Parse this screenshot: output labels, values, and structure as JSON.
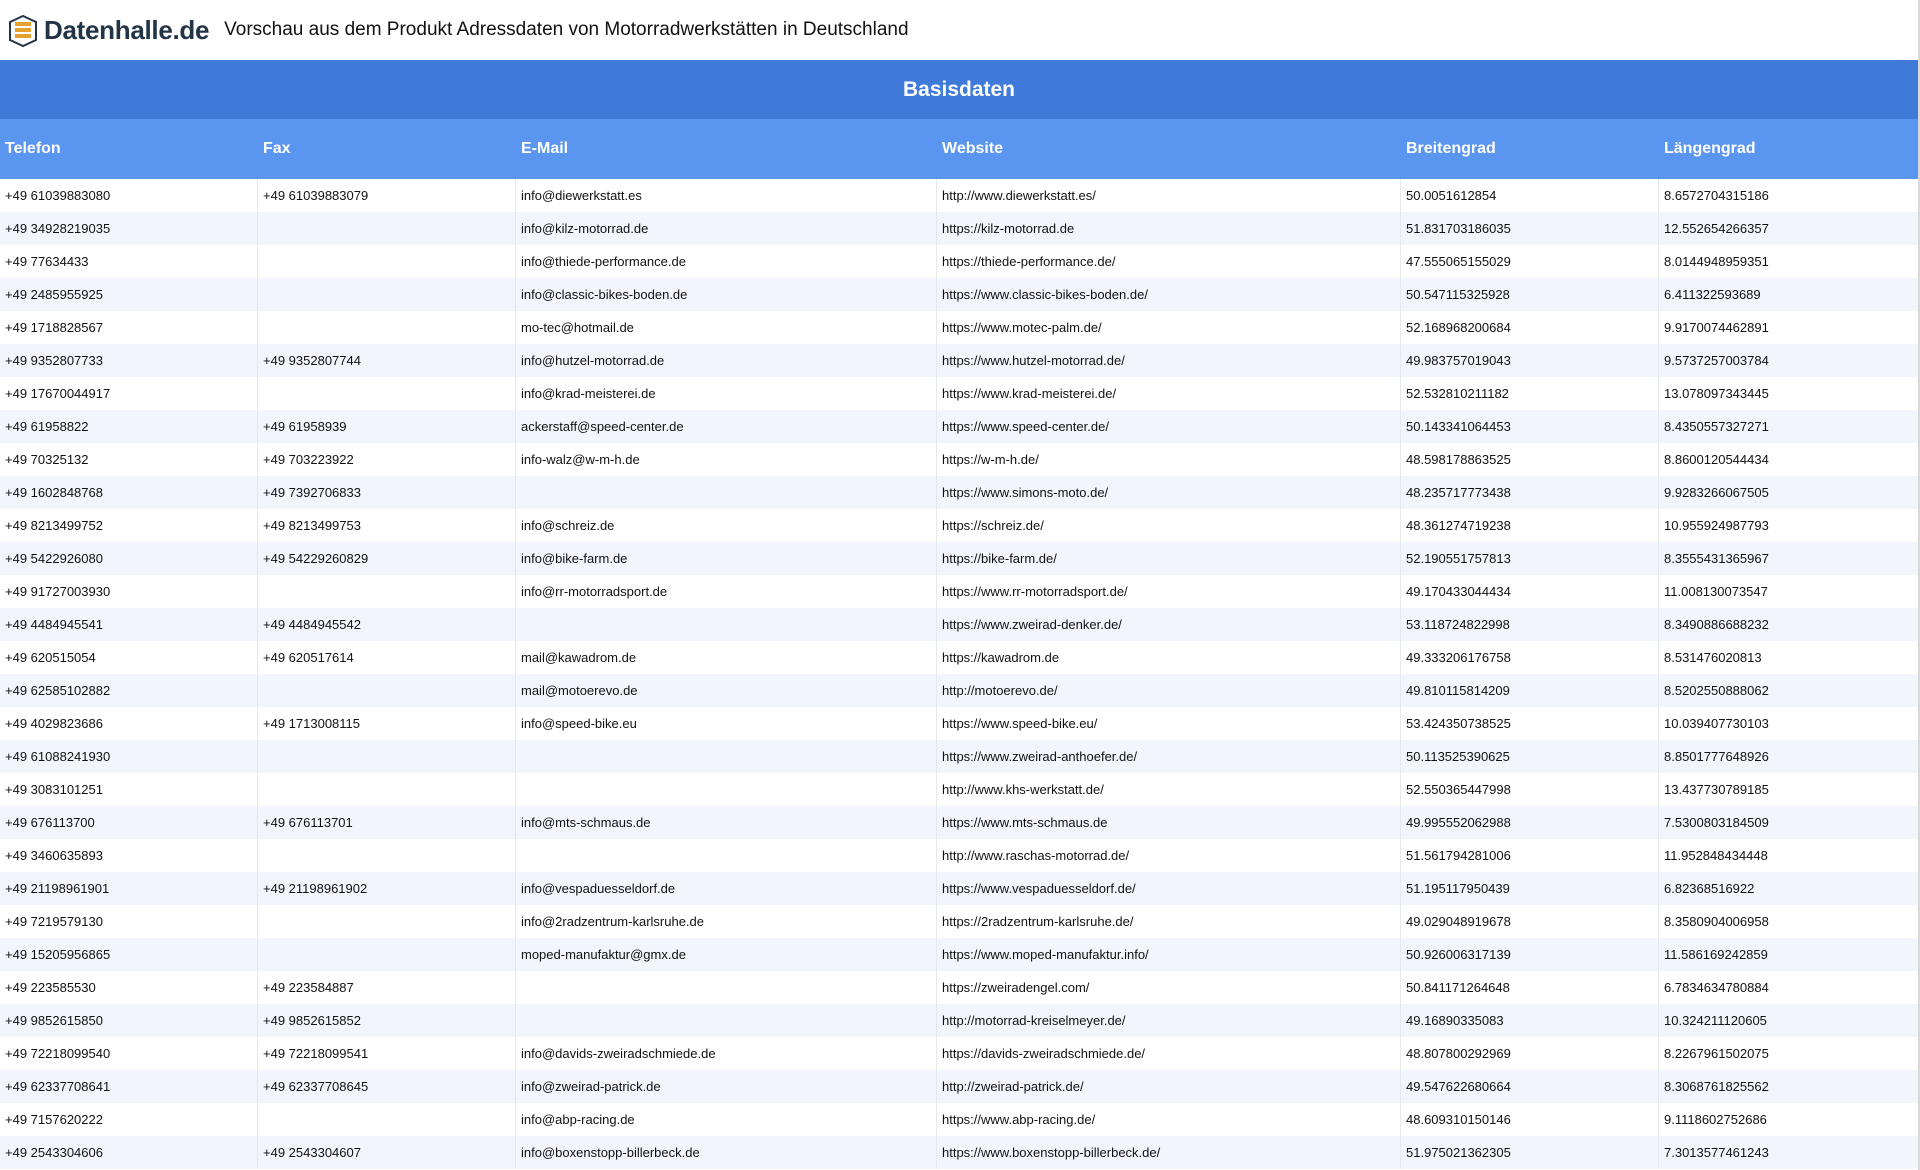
{
  "header": {
    "logo_text": "Datenhalle.de",
    "title": "Vorschau aus dem Produkt Adressdaten von Motorradwerkstätten in Deutschland"
  },
  "table": {
    "group_title": "Basisdaten",
    "columns": [
      "Telefon",
      "Fax",
      "E-Mail",
      "Website",
      "Breitengrad",
      "Längengrad"
    ],
    "rows": [
      [
        "+49 61039883080",
        "+49 61039883079",
        "info@diewerkstatt.es",
        "http://www.diewerkstatt.es/",
        "50.0051612854",
        "8.6572704315186"
      ],
      [
        "+49 34928219035",
        "",
        "info@kilz-motorrad.de",
        "https://kilz-motorrad.de",
        "51.831703186035",
        "12.552654266357"
      ],
      [
        "+49 77634433",
        "",
        "info@thiede-performance.de",
        "https://thiede-performance.de/",
        "47.555065155029",
        "8.0144948959351"
      ],
      [
        "+49 2485955925",
        "",
        "info@classic-bikes-boden.de",
        "https://www.classic-bikes-boden.de/",
        "50.547115325928",
        "6.411322593689"
      ],
      [
        "+49 1718828567",
        "",
        "mo-tec@hotmail.de",
        "https://www.motec-palm.de/",
        "52.168968200684",
        "9.9170074462891"
      ],
      [
        "+49 9352807733",
        "+49 9352807744",
        "info@hutzel-motorrad.de",
        "https://www.hutzel-motorrad.de/",
        "49.983757019043",
        "9.5737257003784"
      ],
      [
        "+49 17670044917",
        "",
        "info@krad-meisterei.de",
        "https://www.krad-meisterei.de/",
        "52.532810211182",
        "13.078097343445"
      ],
      [
        "+49 61958822",
        "+49 61958939",
        "ackerstaff@speed-center.de",
        "https://www.speed-center.de/",
        "50.143341064453",
        "8.4350557327271"
      ],
      [
        "+49 70325132",
        "+49 703223922",
        "info-walz@w-m-h.de",
        "https://w-m-h.de/",
        "48.598178863525",
        "8.8600120544434"
      ],
      [
        "+49 1602848768",
        "+49 7392706833",
        "",
        "https://www.simons-moto.de/",
        "48.235717773438",
        "9.9283266067505"
      ],
      [
        "+49 8213499752",
        "+49 8213499753",
        "info@schreiz.de",
        "https://schreiz.de/",
        "48.361274719238",
        "10.955924987793"
      ],
      [
        "+49 5422926080",
        "+49 54229260829",
        "info@bike-farm.de",
        "https://bike-farm.de/",
        "52.190551757813",
        "8.3555431365967"
      ],
      [
        "+49 91727003930",
        "",
        "info@rr-motorradsport.de",
        "https://www.rr-motorradsport.de/",
        "49.170433044434",
        "11.008130073547"
      ],
      [
        "+49 4484945541",
        "+49 4484945542",
        "",
        "https://www.zweirad-denker.de/",
        "53.118724822998",
        "8.3490886688232"
      ],
      [
        "+49 620515054",
        "+49 620517614",
        "mail@kawadrom.de",
        "https://kawadrom.de",
        "49.333206176758",
        "8.531476020813"
      ],
      [
        "+49 62585102882",
        "",
        "mail@motoerevo.de",
        "http://motoerevo.de/",
        "49.810115814209",
        "8.5202550888062"
      ],
      [
        "+49 4029823686",
        "+49 1713008115",
        "info@speed-bike.eu",
        "https://www.speed-bike.eu/",
        "53.424350738525",
        "10.039407730103"
      ],
      [
        "+49 61088241930",
        "",
        "",
        "https://www.zweirad-anthoefer.de/",
        "50.113525390625",
        "8.8501777648926"
      ],
      [
        "+49 3083101251",
        "",
        "",
        "http://www.khs-werkstatt.de/",
        "52.550365447998",
        "13.437730789185"
      ],
      [
        "+49 676113700",
        "+49 676113701",
        "info@mts-schmaus.de",
        "https://www.mts-schmaus.de",
        "49.995552062988",
        "7.5300803184509"
      ],
      [
        "+49 3460635893",
        "",
        "",
        "http://www.raschas-motorrad.de/",
        "51.561794281006",
        "11.952848434448"
      ],
      [
        "+49 21198961901",
        "+49 21198961902",
        "info@vespaduesseldorf.de",
        "https://www.vespaduesseldorf.de/",
        "51.195117950439",
        "6.82368516922"
      ],
      [
        "+49 7219579130",
        "",
        "info@2radzentrum-karlsruhe.de",
        "https://2radzentrum-karlsruhe.de/",
        "49.029048919678",
        "8.3580904006958"
      ],
      [
        "+49 15205956865",
        "",
        "moped-manufaktur@gmx.de",
        "https://www.moped-manufaktur.info/",
        "50.926006317139",
        "11.586169242859"
      ],
      [
        "+49 223585530",
        "+49 223584887",
        "",
        "https://zweiradengel.com/",
        "50.841171264648",
        "6.7834634780884"
      ],
      [
        "+49 9852615850",
        "+49 9852615852",
        "",
        "http://motorrad-kreiselmeyer.de/",
        "49.16890335083",
        "10.324211120605"
      ],
      [
        "+49 72218099540",
        "+49 72218099541",
        "info@davids-zweiradschmiede.de",
        "https://davids-zweiradschmiede.de/",
        "48.807800292969",
        "8.2267961502075"
      ],
      [
        "+49 62337708641",
        "+49 62337708645",
        "info@zweirad-patrick.de",
        "http://zweirad-patrick.de/",
        "49.547622680664",
        "8.3068761825562"
      ],
      [
        "+49 7157620222",
        "",
        "info@abp-racing.de",
        "https://www.abp-racing.de/",
        "48.609310150146",
        "9.1118602752686"
      ],
      [
        "+49 2543304606",
        "+49 2543304607",
        "info@boxenstopp-billerbeck.de",
        "https://www.boxenstopp-billerbeck.de/",
        "51.975021362305",
        "7.3013577461243"
      ]
    ]
  },
  "colors": {
    "band": "#3f7ad9",
    "column_header": "#5a95ef",
    "row_alt": "#f2f6fc"
  }
}
